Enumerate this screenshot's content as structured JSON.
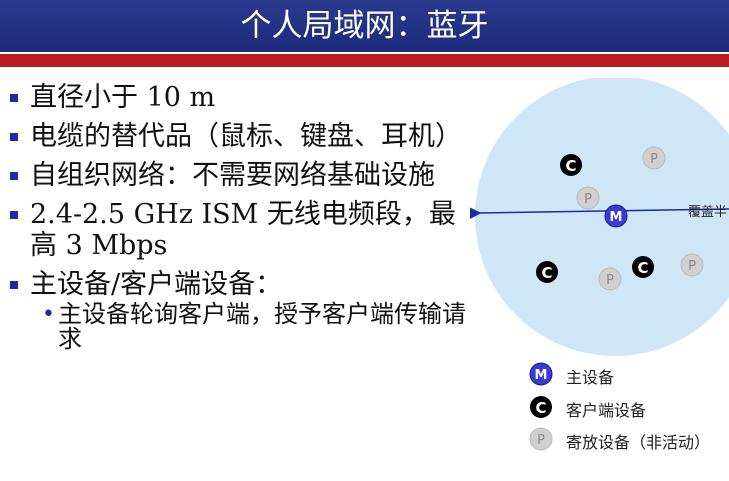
{
  "title": "个人局域网：蓝牙",
  "bullets": [
    "直径小于 10 m",
    "电缆的替代品（鼠标、键盘、耳机）",
    "自组织网络：不需要网络基础设施",
    "2.4-2.5 GHz ISM 无线电频段，最高 3 Mbps",
    "主设备/客户端设备："
  ],
  "sub_bullet": "主设备轮询客户端，授予客户端传输请求",
  "diagram": {
    "coverage_label": "覆盖半",
    "master_letter": "M",
    "client_letter": "C",
    "parked_letter": "P",
    "colors": {
      "coverage": "#cfe6f7",
      "master": "#3a3ad6",
      "client": "#000000",
      "parked": "#d0d0d0",
      "arrow": "#1b2aa8"
    }
  },
  "legend": {
    "master": "主设备",
    "client": "客户端设备",
    "parked": "寄放设备（非活动）"
  }
}
